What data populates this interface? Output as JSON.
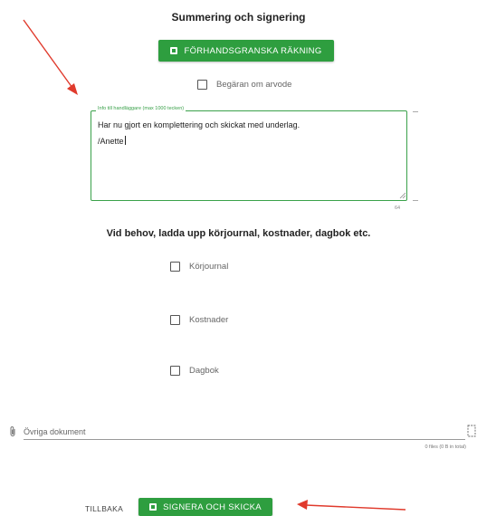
{
  "summary": {
    "title": "Summering och signering",
    "preview_button": "FÖRHANDSGRANSKA RÄKNING",
    "fee_request_label": "Begäran om arvode"
  },
  "info_field": {
    "legend": "Info till handläggare (max 1000 tecken)",
    "value_line1": "Har nu gjort en komplettering och skickat med underlag.",
    "value_line2": "/Anette",
    "char_count": "64"
  },
  "uploads": {
    "heading": "Vid behov, ladda upp körjournal, kostnader, dagbok etc.",
    "items": [
      {
        "label": "Körjournal"
      },
      {
        "label": "Kostnader"
      },
      {
        "label": "Dagbok"
      }
    ],
    "other_docs_label": "Övriga dokument",
    "files_summary": "0 files (0 B in total)"
  },
  "footer": {
    "back_label": "TILLBAKA",
    "submit_label": "SIGNERA OCH SKICKA"
  },
  "colors": {
    "accent_green": "#2e9e3f",
    "annotation_arrow": "#e03a2c"
  },
  "icons": [
    "document-icon",
    "paperclip-icon",
    "file-browse-icon",
    "resize-handle-icon",
    "annotation-arrow"
  ]
}
